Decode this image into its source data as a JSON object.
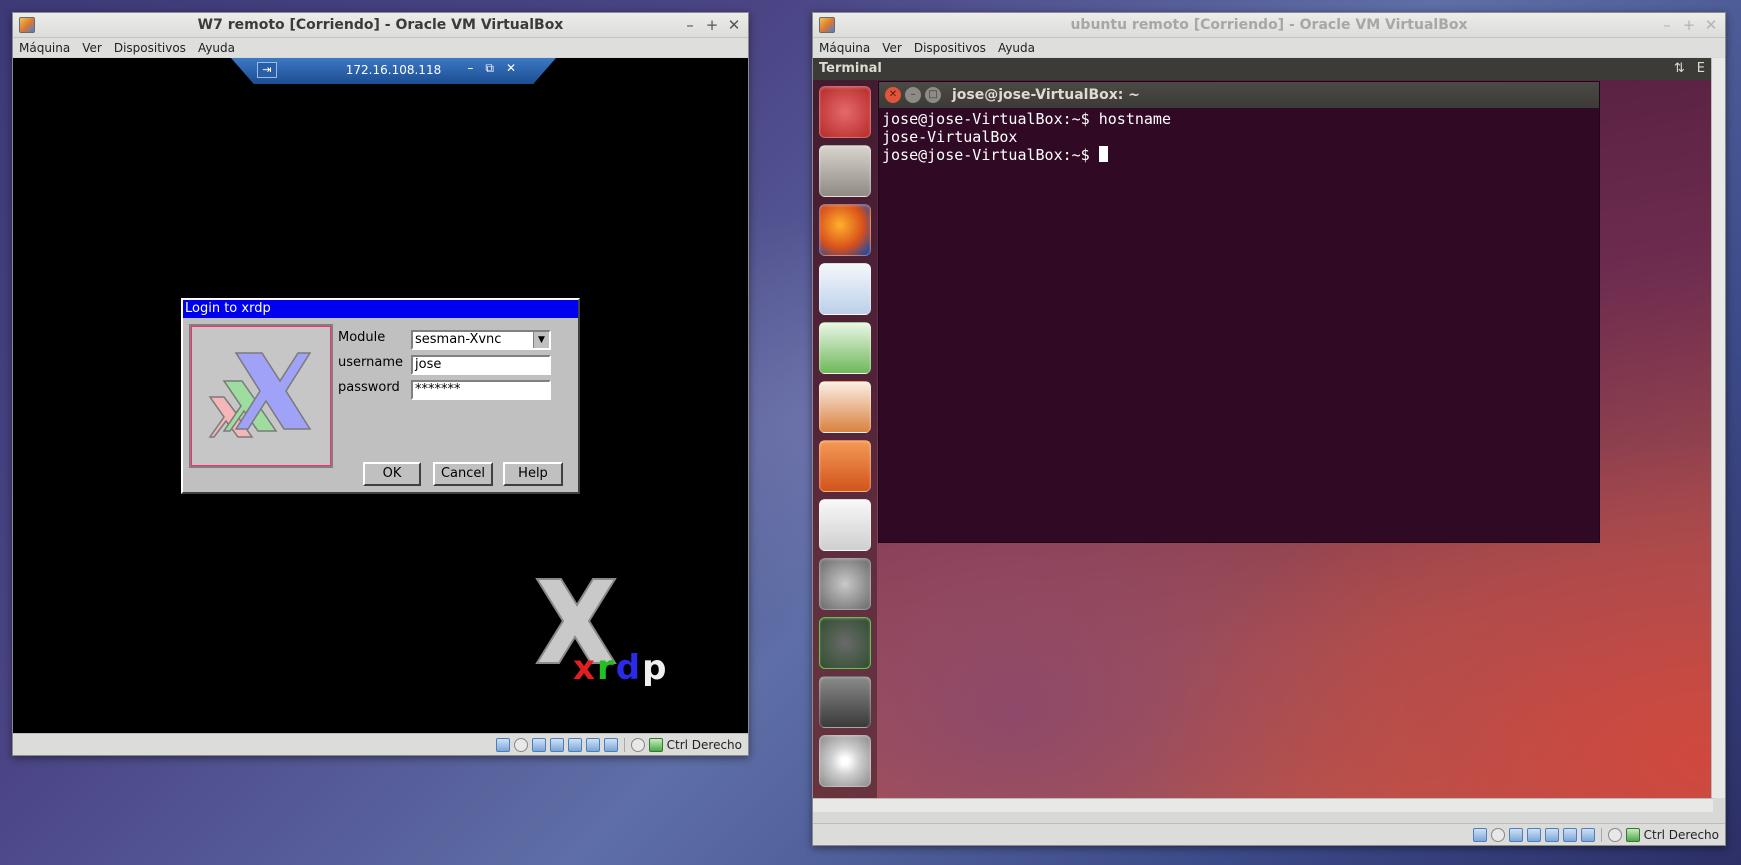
{
  "w7_window": {
    "title": "W7 remoto [Corriendo] - Oracle VM VirtualBox",
    "menu": [
      "Máquina",
      "Ver",
      "Dispositivos",
      "Ayuda"
    ],
    "controls": {
      "minimize": "–",
      "maximize": "+",
      "close": "✕"
    },
    "rdp_bar": {
      "pin": "⇥",
      "host": "172.16.108.118",
      "minimize": "–",
      "restore": "⧉",
      "close": "✕"
    },
    "login_dialog": {
      "title": "Login to xrdp",
      "module_label": "Module",
      "module_value": "sesman-Xvnc",
      "username_label": "username",
      "username_value": "jose",
      "password_label": "password",
      "password_value": "*******",
      "buttons": {
        "ok": "OK",
        "cancel": "Cancel",
        "help": "Help"
      }
    },
    "xrdp_logo": {
      "x": "x",
      "r": "r",
      "d": "d",
      "p": "p"
    },
    "status_host_key": "Ctrl Derecho"
  },
  "ubuntu_window": {
    "title": "ubuntu remoto [Corriendo] - Oracle VM VirtualBox",
    "menu": [
      "Máquina",
      "Ver",
      "Dispositivos",
      "Ayuda"
    ],
    "controls": {
      "minimize": "–",
      "maximize": "+",
      "close": "✕"
    },
    "panel_title": "Terminal",
    "panel_icons": {
      "network": "⇅",
      "keyboard": "E"
    },
    "terminal": {
      "title": "jose@jose-VirtualBox: ~",
      "lines": [
        "jose@jose-VirtualBox:~$ hostname",
        "jose-VirtualBox",
        "jose@jose-VirtualBox:~$ "
      ]
    },
    "launcher_items": [
      "dash-home",
      "files",
      "firefox",
      "writer",
      "calc",
      "impress",
      "software-center",
      "amazon",
      "system-settings",
      "software-updater",
      "terminal",
      "dvd"
    ],
    "status_host_key": "Ctrl Derecho"
  },
  "colors": {
    "dialog_title_bg": "#0000f0",
    "terminal_bg": "#300a24",
    "ubuntu_panel": "#3c3b37"
  }
}
